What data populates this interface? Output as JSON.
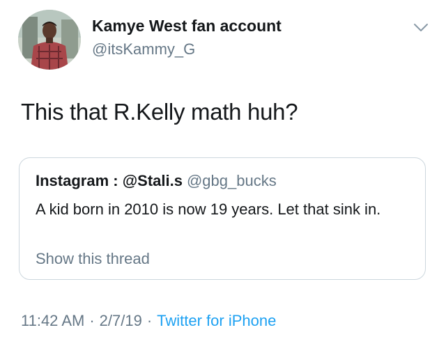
{
  "tweet": {
    "display_name": "Kamye West fan account",
    "handle": "@itsKammy_G",
    "text": "This that R.Kelly math huh?",
    "time": "11:42 AM",
    "separator": "·",
    "date": "2/7/19",
    "source": "Twitter for iPhone"
  },
  "quoted_tweet": {
    "display_name": "Instagram : @Stali.s",
    "handle": "@gbg_bucks",
    "text": "A kid born in 2010 is now 19 years. Let that sink in.",
    "show_thread": "Show this thread"
  },
  "icons": {
    "avatar": "profile-photo",
    "menu": "chevron-down-icon"
  },
  "colors": {
    "text": "#14171a",
    "secondary": "#657786",
    "link": "#1da1f2",
    "border": "#ccd6dd"
  }
}
